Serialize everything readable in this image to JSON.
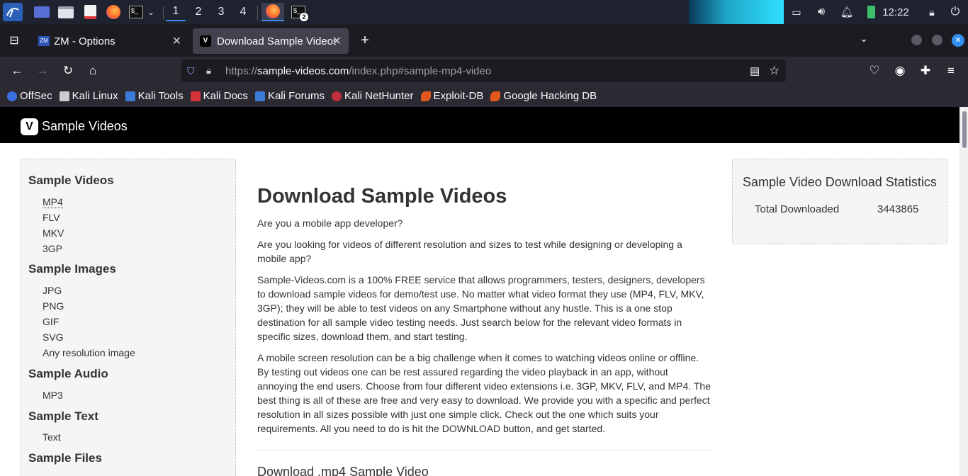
{
  "taskbar": {
    "workspaces": [
      "1",
      "2",
      "3",
      "4"
    ],
    "clock": "12:22",
    "terminal_badge": "2"
  },
  "browser": {
    "tabs": [
      {
        "label": "ZM - Options",
        "favicon": "ZM"
      },
      {
        "label": "Download Sample Videos",
        "favicon": "V"
      }
    ],
    "url": {
      "scheme": "https://",
      "host": "sample-videos.com",
      "path": "/index.php#sample-mp4-video"
    },
    "bookmarks": [
      "OffSec",
      "Kali Linux",
      "Kali Tools",
      "Kali Docs",
      "Kali Forums",
      "Kali NetHunter",
      "Exploit-DB",
      "Google Hacking DB"
    ]
  },
  "site": {
    "logo_letter": "V",
    "brand": "Sample Videos",
    "sidebar": {
      "videos_head": "Sample Videos",
      "videos": [
        "MP4",
        "FLV",
        "MKV",
        "3GP"
      ],
      "images_head": "Sample Images",
      "images": [
        "JPG",
        "PNG",
        "GIF",
        "SVG",
        "Any resolution image"
      ],
      "audio_head": "Sample Audio",
      "audio": [
        "MP3"
      ],
      "text_head": "Sample Text",
      "text": [
        "Text"
      ],
      "files_head": "Sample Files"
    },
    "main": {
      "title": "Download Sample Videos",
      "p1": "Are you a mobile app developer?",
      "p2": "Are you looking for videos of different resolution and sizes to test while designing or developing a mobile app?",
      "p3": "Sample-Videos.com is a 100% FREE service that allows programmers, testers, designers, developers to download sample videos for demo/test use. No matter what video format they use (MP4, FLV, MKV, 3GP); they will be able to test videos on any Smartphone without any hustle. This is a one stop destination for all sample video testing needs. Just search below for the relevant video formats in specific sizes, download them, and start testing.",
      "p4": "A mobile screen resolution can be a big challenge when it comes to watching videos online or offline. By testing out videos one can be rest assured regarding the video playback in an app, without annoying the end users. Choose from four different video extensions i.e. 3GP, MKV, FLV, and MP4. The best thing is all of these are free and very easy to download. We provide you with a specific and perfect resolution in all sizes possible with just one simple click. Check out the one which suits your requirements. All you need to do is hit the DOWNLOAD button, and get started.",
      "subheading": "Download .mp4 Sample Video"
    },
    "stats": {
      "title": "Sample Video Download Statistics",
      "label": "Total Downloaded",
      "value": "3443865"
    }
  }
}
